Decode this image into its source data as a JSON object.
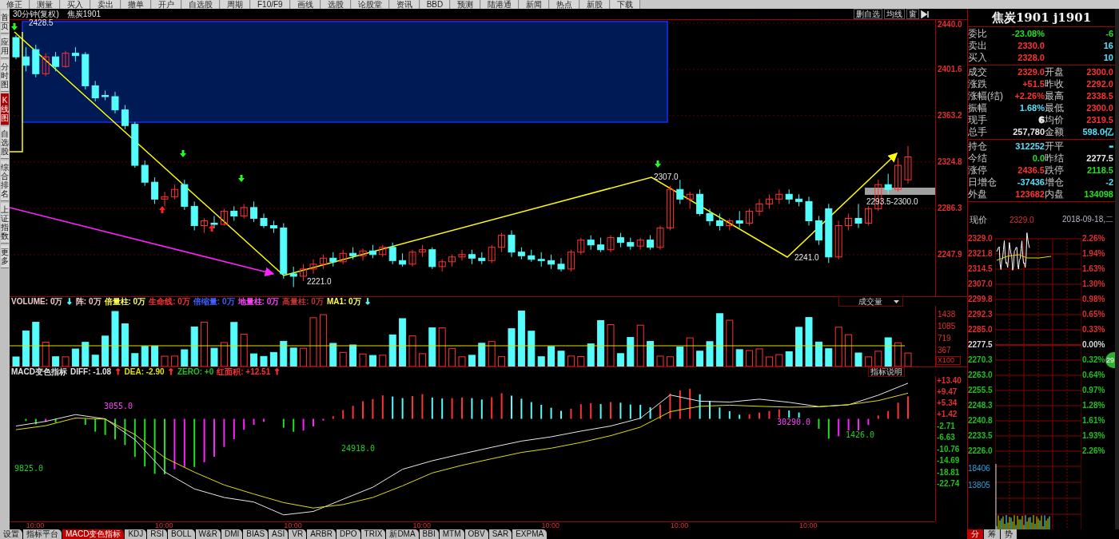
{
  "toolbar": {
    "items": [
      "修正",
      "测量",
      "买入",
      "卖出",
      "撤单",
      "开户",
      "自选股",
      "周期",
      "F10/F9",
      "画线",
      "选股",
      "论股堂",
      "资讯",
      "BBD",
      "预测",
      "陆港通",
      "新闻",
      "热点",
      "新股",
      "下载"
    ]
  },
  "sidebar": {
    "items": [
      {
        "label": "首页",
        "selected": false
      },
      {
        "label": "应用",
        "selected": false
      },
      {
        "label": "分时图",
        "selected": false
      },
      {
        "label": "K线图",
        "selected": true
      },
      {
        "label": "自选股",
        "selected": false
      },
      {
        "label": "综合排名",
        "selected": false
      },
      {
        "label": "上证指数",
        "selected": false
      },
      {
        "label": "更多",
        "selected": false
      }
    ]
  },
  "chart_header": {
    "period": "30分钟(复权)",
    "symbol": "焦炭1901",
    "buttons": [
      "删自选",
      "均线",
      "窗"
    ]
  },
  "price_chart": {
    "annotations": [
      "2428.5",
      "2221.0",
      "2307.0",
      "2241.0",
      "2293.5-2300.0"
    ],
    "chart_data": {
      "type": "candlestick",
      "ylim": [
        2213.4,
        2442.6
      ],
      "yticks": [
        {
          "value": 2440,
          "label": "2440.0"
        },
        {
          "value": 2401.6,
          "label": "2401.6"
        },
        {
          "value": 2363.2,
          "label": "2363.2"
        },
        {
          "value": 2324.8,
          "label": "2324.8"
        },
        {
          "value": 2286.3,
          "label": "2286.3"
        },
        {
          "value": 2247.9,
          "label": "2247.9"
        }
      ],
      "grid": true,
      "ohlc": [
        [
          2428,
          2430,
          2410,
          2412
        ],
        [
          2412,
          2420,
          2400,
          2405
        ],
        [
          2418,
          2422,
          2395,
          2398
        ],
        [
          2398,
          2415,
          2396,
          2412
        ],
        [
          2412,
          2416,
          2400,
          2404
        ],
        [
          2404,
          2417,
          2403,
          2415
        ],
        [
          2415,
          2420,
          2408,
          2413
        ],
        [
          2414,
          2416,
          2385,
          2388
        ],
        [
          2388,
          2392,
          2375,
          2378
        ],
        [
          2380,
          2384,
          2376,
          2379
        ],
        [
          2379,
          2383,
          2365,
          2368
        ],
        [
          2368,
          2372,
          2352,
          2355
        ],
        [
          2356,
          2358,
          2320,
          2322
        ],
        [
          2322,
          2326,
          2305,
          2308
        ],
        [
          2308,
          2312,
          2290,
          2294
        ],
        [
          2294,
          2300,
          2288,
          2296
        ],
        [
          2296,
          2306,
          2294,
          2302
        ],
        [
          2306,
          2310,
          2285,
          2288
        ],
        [
          2288,
          2292,
          2268,
          2272
        ],
        [
          2272,
          2278,
          2266,
          2276
        ],
        [
          2274,
          2280,
          2270,
          2273
        ],
        [
          2273,
          2286,
          2272,
          2284
        ],
        [
          2284,
          2288,
          2276,
          2280
        ],
        [
          2280,
          2290,
          2278,
          2287
        ],
        [
          2287,
          2292,
          2275,
          2278
        ],
        [
          2278,
          2282,
          2270,
          2272
        ],
        [
          2272,
          2276,
          2266,
          2270
        ],
        [
          2270,
          2274,
          2228,
          2232
        ],
        [
          2232,
          2238,
          2221,
          2230
        ],
        [
          2230,
          2240,
          2226,
          2236
        ],
        [
          2236,
          2244,
          2232,
          2240
        ],
        [
          2240,
          2248,
          2236,
          2245
        ],
        [
          2245,
          2250,
          2238,
          2242
        ],
        [
          2242,
          2252,
          2240,
          2249
        ],
        [
          2249,
          2254,
          2244,
          2247
        ],
        [
          2247,
          2253,
          2243,
          2251
        ],
        [
          2251,
          2256,
          2245,
          2248
        ],
        [
          2248,
          2256,
          2246,
          2254
        ],
        [
          2254,
          2258,
          2240,
          2243
        ],
        [
          2243,
          2249,
          2238,
          2240
        ],
        [
          2240,
          2252,
          2238,
          2250
        ],
        [
          2250,
          2256,
          2246,
          2252
        ],
        [
          2252,
          2254,
          2236,
          2238
        ],
        [
          2238,
          2244,
          2234,
          2242
        ],
        [
          2242,
          2248,
          2238,
          2246
        ],
        [
          2246,
          2252,
          2243,
          2248
        ],
        [
          2248,
          2252,
          2240,
          2245
        ],
        [
          2245,
          2250,
          2240,
          2243
        ],
        [
          2243,
          2256,
          2241,
          2254
        ],
        [
          2254,
          2266,
          2250,
          2264
        ],
        [
          2264,
          2268,
          2246,
          2250
        ],
        [
          2250,
          2254,
          2244,
          2247
        ],
        [
          2247,
          2252,
          2242,
          2244
        ],
        [
          2244,
          2250,
          2238,
          2243
        ],
        [
          2243,
          2248,
          2236,
          2240
        ],
        [
          2240,
          2245,
          2234,
          2236
        ],
        [
          2236,
          2252,
          2234,
          2250
        ],
        [
          2250,
          2262,
          2248,
          2260
        ],
        [
          2260,
          2264,
          2252,
          2256
        ],
        [
          2256,
          2262,
          2250,
          2252
        ],
        [
          2252,
          2264,
          2250,
          2262
        ],
        [
          2262,
          2266,
          2254,
          2258
        ],
        [
          2258,
          2262,
          2252,
          2255
        ],
        [
          2255,
          2262,
          2252,
          2260
        ],
        [
          2260,
          2264,
          2252,
          2254
        ],
        [
          2254,
          2272,
          2252,
          2270
        ],
        [
          2270,
          2305,
          2268,
          2302
        ],
        [
          2302,
          2310,
          2290,
          2294
        ],
        [
          2294,
          2300,
          2286,
          2298
        ],
        [
          2298,
          2302,
          2280,
          2282
        ],
        [
          2282,
          2286,
          2272,
          2276
        ],
        [
          2276,
          2282,
          2268,
          2272
        ],
        [
          2272,
          2278,
          2268,
          2276
        ],
        [
          2276,
          2284,
          2270,
          2274
        ],
        [
          2274,
          2286,
          2272,
          2284
        ],
        [
          2284,
          2294,
          2280,
          2290
        ],
        [
          2290,
          2298,
          2286,
          2294
        ],
        [
          2294,
          2302,
          2290,
          2298
        ],
        [
          2298,
          2302,
          2290,
          2294
        ],
        [
          2294,
          2298,
          2288,
          2292
        ],
        [
          2292,
          2296,
          2272,
          2276
        ],
        [
          2276,
          2280,
          2256,
          2260
        ],
        [
          2286,
          2290,
          2241,
          2246
        ],
        [
          2246,
          2276,
          2244,
          2272
        ],
        [
          2272,
          2282,
          2268,
          2278
        ],
        [
          2278,
          2290,
          2270,
          2274
        ],
        [
          2274,
          2288,
          2272,
          2286
        ],
        [
          2286,
          2310,
          2284,
          2306
        ],
        [
          2306,
          2315,
          2298,
          2302
        ],
        [
          2302,
          2328,
          2300,
          2322
        ],
        [
          2310,
          2338,
          2307,
          2329
        ]
      ]
    }
  },
  "volume": {
    "legend": [
      {
        "text": "VOLUME: 0万",
        "color": "#f0c8c8"
      },
      {
        "text": "↓",
        "color": "#54fcfc"
      },
      {
        "text": "阵: 0万",
        "color": "#f0c8c8"
      },
      {
        "text": "倍量柱: 0万",
        "color": "#ffff50"
      },
      {
        "text": "生命线: 0万",
        "color": "#ff3030"
      },
      {
        "text": "倍缩量: 0万",
        "color": "#4060ff"
      },
      {
        "text": "地量柱: 0万",
        "color": "#ff40ff"
      },
      {
        "text": "高量柱: 0万",
        "color": "#c03030"
      },
      {
        "text": "MA1: 0万",
        "color": "#ffff50"
      },
      {
        "text": "↓",
        "color": "#54fcfc"
      }
    ],
    "selector": "成交量",
    "axis": [
      "1438",
      "1085",
      "719",
      "367"
    ],
    "unit": "X100"
  },
  "macd": {
    "legend": [
      {
        "text": "MACD变色指标",
        "color": "#e0e0e0"
      },
      {
        "text": "DIFF: -1.08",
        "color": "#e0e0e0"
      },
      {
        "text": "↑",
        "color": "#ff3030"
      },
      {
        "text": "DEA: -2.90",
        "color": "#e0e000"
      },
      {
        "text": "↑",
        "color": "#ff3030"
      },
      {
        "text": "ZERO: +0",
        "color": "#20c020"
      },
      {
        "text": "红面积: +12.51",
        "color": "#ff3030"
      },
      {
        "text": "↑",
        "color": "#ff3030"
      }
    ],
    "button": "指标说明",
    "annotations": [
      {
        "text": "3055.0",
        "color": "#ff40ff"
      },
      {
        "text": "9825.0",
        "color": "#20d020"
      },
      {
        "text": "24918.0",
        "color": "#20d020"
      },
      {
        "text": "30290.0",
        "color": "#ff40ff"
      },
      {
        "text": "1426.0",
        "color": "#20d020"
      }
    ],
    "chart_data": {
      "type": "line",
      "ylim": [
        -36,
        15
      ],
      "yticks": [
        {
          "value": 13.4,
          "label": "+13.40"
        },
        {
          "value": 9.47,
          "label": "+9.47"
        },
        {
          "value": 5.34,
          "label": "+5.34"
        },
        {
          "value": 1.42,
          "label": "+1.42"
        },
        {
          "value": -2.71,
          "label": "-2.71"
        },
        {
          "value": -6.63,
          "label": "-6.63"
        },
        {
          "value": -10.76,
          "label": "-10.76"
        },
        {
          "value": -14.69,
          "label": "-14.69"
        },
        {
          "value": -18.81,
          "label": "-18.81"
        },
        {
          "value": -22.74,
          "label": "-22.74"
        }
      ],
      "series": [
        {
          "color": "#e8e8e8",
          "values": [
            -2.5,
            -0.9,
            1.5,
            0,
            -7.3,
            -18.6,
            -24.6,
            -27.6,
            -29.2,
            -33.7,
            -32.5,
            -28.2,
            -24,
            -17.7,
            -14.7,
            -12.3,
            -10,
            -7.8,
            -6.3,
            -4.3,
            -2.5,
            0.2,
            8.4,
            6.2,
            5.9,
            6.9,
            5.8,
            4.3,
            4.9,
            8.3,
            12.5
          ]
        },
        {
          "color": "#e0e000",
          "values": [
            -3.8,
            -2.4,
            0.3,
            -0.1,
            -5.5,
            -13.6,
            -18.7,
            -23.2,
            -26.4,
            -29.4,
            -31.3,
            -30.1,
            -27.6,
            -23.5,
            -19,
            -16.3,
            -14,
            -11.8,
            -10.3,
            -8.3,
            -5.9,
            -2.9,
            2.5,
            4.4,
            4.8,
            4.4,
            4.1,
            4.2,
            5,
            6.4,
            9
          ]
        }
      ]
    }
  },
  "time_axis": [
    "10:00",
    "10:00",
    "10:00",
    "10:00",
    "10:00",
    "10:00",
    "10:00"
  ],
  "indicator_tabs": [
    {
      "label": "设置",
      "selected": false
    },
    {
      "label": "指标平台",
      "selected": false
    },
    {
      "label": "MACD变色指标",
      "selected": true
    },
    {
      "label": "KDJ",
      "selected": false
    },
    {
      "label": "RSI",
      "selected": false
    },
    {
      "label": "BOLL",
      "selected": false
    },
    {
      "label": "W&R",
      "selected": false
    },
    {
      "label": "DMI",
      "selected": false
    },
    {
      "label": "BIAS",
      "selected": false
    },
    {
      "label": "ASI",
      "selected": false
    },
    {
      "label": "VR",
      "selected": false
    },
    {
      "label": "ARBR",
      "selected": false
    },
    {
      "label": "DPO",
      "selected": false
    },
    {
      "label": "TRIX",
      "selected": false
    },
    {
      "label": "新DMA",
      "selected": false
    },
    {
      "label": "BBI",
      "selected": false
    },
    {
      "label": "MTM",
      "selected": false
    },
    {
      "label": "OBV",
      "selected": false
    },
    {
      "label": "SAR",
      "selected": false
    },
    {
      "label": "EXPMA",
      "selected": false
    }
  ],
  "quote": {
    "title": "焦炭1901 j1901",
    "groups": [
      [
        {
          "cells": [
            {
              "label": "委比",
              "value": "-23.08%",
              "color": "#20e020"
            },
            {
              "value": "-6",
              "color": "#20e020"
            }
          ]
        },
        {
          "cells": [
            {
              "label": "卖出",
              "value": "2330.0",
              "color": "#ff3232"
            },
            {
              "value": "16",
              "color": "#54e0fc"
            }
          ]
        },
        {
          "cells": [
            {
              "label": "买入",
              "value": "2328.0",
              "color": "#ff3232"
            },
            {
              "value": "10",
              "color": "#54e0fc"
            }
          ]
        }
      ],
      [
        {
          "cells": [
            {
              "label": "成交",
              "value": "2329.0",
              "color": "#ff3232"
            },
            {
              "label": "开盘",
              "value": "2300.0",
              "color": "#ff3232"
            }
          ]
        },
        {
          "cells": [
            {
              "label": "涨跌",
              "value": "+51.5",
              "color": "#ff3232"
            },
            {
              "label": "昨收",
              "value": "2292.0",
              "color": "#ff3232"
            }
          ]
        },
        {
          "cells": [
            {
              "label": "涨幅(结)",
              "value": "+2.26%",
              "color": "#ff3232"
            },
            {
              "label": "最高",
              "value": "2338.5",
              "color": "#ff3232"
            }
          ]
        },
        {
          "cells": [
            {
              "label": "振幅",
              "value": "1.68%",
              "color": "#54e0fc"
            },
            {
              "label": "最低",
              "value": "2300.0",
              "color": "#ff3232"
            }
          ]
        },
        {
          "cells": [
            {
              "label": "现手",
              "value": "6",
              "color": "#e8e8e8"
            },
            {
              "label": "均价",
              "value": "2319.5",
              "color": "#ff3232"
            }
          ]
        },
        {
          "cells": [
            {
              "label": "总手",
              "value": "257,780",
              "color": "#e8e8e8"
            },
            {
              "label": "金额",
              "value": "598.0亿",
              "color": "#54e0fc"
            }
          ]
        }
      ],
      [
        {
          "cells": [
            {
              "label": "持仓",
              "value": "312252",
              "color": "#54e0fc"
            },
            {
              "label": "开平",
              "value": "–",
              "color": "#54e0fc"
            }
          ]
        },
        {
          "cells": [
            {
              "label": "今结",
              "value": "0.0",
              "color": "#20e020"
            },
            {
              "label": "昨结",
              "value": "2277.5",
              "color": "#e8e8e8"
            }
          ]
        },
        {
          "cells": [
            {
              "label": "涨停",
              "value": "2436.5",
              "color": "#ff3232"
            },
            {
              "label": "跌停",
              "value": "2118.5",
              "color": "#20e020"
            }
          ]
        },
        {
          "cells": [
            {
              "label": "日增仓",
              "value": "-37436",
              "color": "#54e0fc"
            },
            {
              "label": "增仓",
              "value": "-2",
              "color": "#54e0fc"
            }
          ]
        },
        {
          "cells": [
            {
              "label": "外盘",
              "value": "123682",
              "color": "#ff3232"
            },
            {
              "label": "内盘",
              "value": "134098",
              "color": "#20e020"
            }
          ]
        }
      ]
    ],
    "price_label": "现价",
    "price": "2329.0",
    "date": "2018-09-18,二"
  },
  "intraday": {
    "price_labels": [
      {
        "text": "2329.0",
        "color": "#e03030"
      },
      {
        "text": "2321.8",
        "color": "#e03030"
      },
      {
        "text": "2314.5",
        "color": "#e03030"
      },
      {
        "text": "2307.0",
        "color": "#e03030"
      },
      {
        "text": "2299.8",
        "color": "#e03030"
      },
      {
        "text": "2292.3",
        "color": "#e03030"
      },
      {
        "text": "2285.0",
        "color": "#e03030"
      },
      {
        "text": "2277.5",
        "color": "#d8d8d8"
      },
      {
        "text": "2270.3",
        "color": "#20c020"
      },
      {
        "text": "2263.0",
        "color": "#20c020"
      },
      {
        "text": "2255.5",
        "color": "#20c020"
      },
      {
        "text": "2248.3",
        "color": "#20c020"
      },
      {
        "text": "2240.8",
        "color": "#20c020"
      },
      {
        "text": "2233.5",
        "color": "#20c020"
      },
      {
        "text": "2226.0",
        "color": "#20c020"
      }
    ],
    "pct_labels": [
      {
        "text": "2.26%",
        "color": "#e03030"
      },
      {
        "text": "1.94%",
        "color": "#e03030"
      },
      {
        "text": "1.63%",
        "color": "#e03030"
      },
      {
        "text": "1.30%",
        "color": "#e03030"
      },
      {
        "text": "0.98%",
        "color": "#e03030"
      },
      {
        "text": "0.65%",
        "color": "#e03030"
      },
      {
        "text": "0.33%",
        "color": "#e03030"
      },
      {
        "text": "0.00%",
        "color": "#d8d8d8"
      },
      {
        "text": "0.32%",
        "color": "#20c020"
      },
      {
        "text": "0.64%",
        "color": "#20c020"
      },
      {
        "text": "0.97%",
        "color": "#20c020"
      },
      {
        "text": "1.28%",
        "color": "#20c020"
      },
      {
        "text": "1.61%",
        "color": "#20c020"
      },
      {
        "text": "1.93%",
        "color": "#20c020"
      },
      {
        "text": "2.26%",
        "color": "#20c020"
      }
    ],
    "volume_labels": [
      "18406",
      "13805"
    ],
    "tabs": [
      {
        "label": "分",
        "selected": true
      },
      {
        "label": "筹",
        "selected": false
      },
      {
        "label": "势",
        "selected": false
      }
    ]
  },
  "badge": "29"
}
